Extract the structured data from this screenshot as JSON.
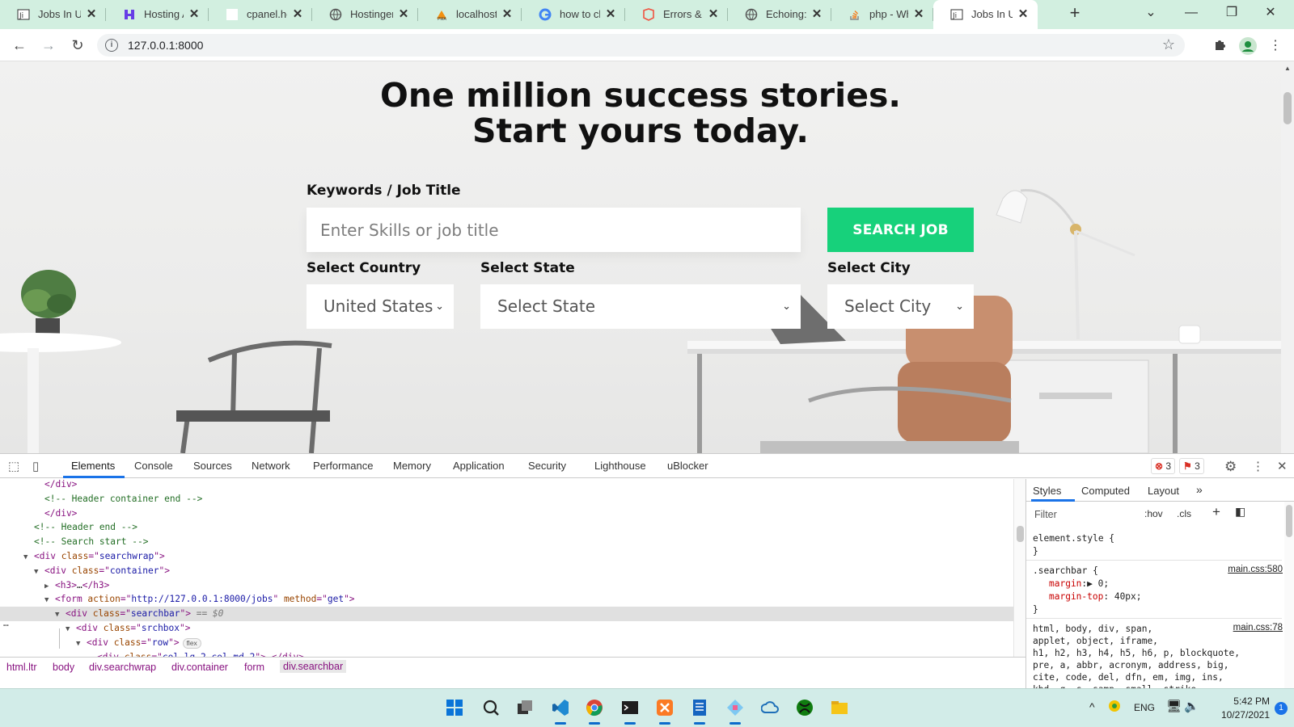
{
  "tabs": [
    {
      "title": "Jobs In Ur",
      "icon": "job-favicon",
      "active": false
    },
    {
      "title": "Hosting A",
      "icon": "hostinger-favicon",
      "active": false
    },
    {
      "title": "cpanel.ho",
      "icon": "blank-favicon",
      "active": false
    },
    {
      "title": "Hostinger",
      "icon": "globe-favicon",
      "active": false
    },
    {
      "title": "localhost",
      "icon": "phpmyadmin-favicon",
      "active": false
    },
    {
      "title": "how to ch",
      "icon": "google-favicon",
      "active": false
    },
    {
      "title": "Errors & L",
      "icon": "laravel-favicon",
      "active": false
    },
    {
      "title": "Echoing: c",
      "icon": "globe-favicon",
      "active": false
    },
    {
      "title": "php - Wh",
      "icon": "stackoverflow-favicon",
      "active": false
    },
    {
      "title": "Jobs In Ur",
      "icon": "job-favicon",
      "active": true
    }
  ],
  "address_bar": {
    "url": "127.0.0.1:8000"
  },
  "page": {
    "hero_line1": "One million success stories.",
    "hero_line2": "Start yours today.",
    "keywords_label": "Keywords / Job Title",
    "keywords_placeholder": "Enter Skills or job title",
    "search_button": "SEARCH JOB",
    "country_label": "Select Country",
    "country_value": "United States",
    "state_label": "Select State",
    "state_value": "Select State",
    "city_label": "Select City",
    "city_value": "Select City"
  },
  "devtools": {
    "tabs": [
      "Elements",
      "Console",
      "Sources",
      "Network",
      "Performance",
      "Memory",
      "Application",
      "Security",
      "Lighthouse",
      "uBlocker"
    ],
    "active_tab": "Elements",
    "errors_count": "3",
    "issues_count": "3",
    "dom_lines": [
      {
        "indent": 1,
        "tri": "",
        "parts": [
          [
            "tg",
            "</div>"
          ]
        ]
      },
      {
        "indent": 1,
        "tri": "",
        "parts": [
          [
            "cm",
            "<!-- Header container end -->"
          ]
        ]
      },
      {
        "indent": 1,
        "tri": "",
        "parts": [
          [
            "tg",
            "</div>"
          ]
        ]
      },
      {
        "indent": 0,
        "tri": "",
        "parts": [
          [
            "cm",
            "<!-- Header end -->"
          ]
        ]
      },
      {
        "indent": 0,
        "tri": "",
        "parts": [
          [
            "cm",
            "<!-- Search start -->"
          ]
        ]
      },
      {
        "indent": 0,
        "tri": "▼",
        "parts": [
          [
            "tg",
            "<div "
          ],
          [
            "an",
            "class"
          ],
          [
            "tg",
            "=\""
          ],
          [
            "av",
            "searchwrap"
          ],
          [
            "tg",
            "\">"
          ]
        ]
      },
      {
        "indent": 1,
        "tri": "▼",
        "parts": [
          [
            "tg",
            "<div "
          ],
          [
            "an",
            "class"
          ],
          [
            "tg",
            "=\""
          ],
          [
            "av",
            "container"
          ],
          [
            "tg",
            "\">"
          ]
        ]
      },
      {
        "indent": 2,
        "tri": "▶",
        "parts": [
          [
            "tg",
            "<h3>"
          ],
          [
            "tx",
            "…"
          ],
          [
            "tg",
            "</h3>"
          ]
        ]
      },
      {
        "indent": 2,
        "tri": "▼",
        "parts": [
          [
            "tg",
            "<form "
          ],
          [
            "an",
            "action"
          ],
          [
            "tg",
            "=\""
          ],
          [
            "av",
            "http://127.0.0.1:8000/jobs"
          ],
          [
            "tg",
            "\" "
          ],
          [
            "an",
            "method"
          ],
          [
            "tg",
            "=\""
          ],
          [
            "av",
            "get"
          ],
          [
            "tg",
            "\">"
          ]
        ]
      },
      {
        "indent": 3,
        "tri": "▼",
        "parts": [
          [
            "tg",
            "<div "
          ],
          [
            "an",
            "class"
          ],
          [
            "tg",
            "=\""
          ],
          [
            "av",
            "searchbar"
          ],
          [
            "tg",
            "\">"
          ],
          [
            "tx",
            " == $0"
          ]
        ],
        "selected": true
      },
      {
        "indent": 4,
        "tri": "▼",
        "parts": [
          [
            "tg",
            "<div "
          ],
          [
            "an",
            "class"
          ],
          [
            "tg",
            "=\""
          ],
          [
            "av",
            "srchbox"
          ],
          [
            "tg",
            "\">"
          ]
        ]
      },
      {
        "indent": 5,
        "tri": "▼",
        "parts": [
          [
            "tg",
            "<div "
          ],
          [
            "an",
            "class"
          ],
          [
            "tg",
            "=\""
          ],
          [
            "av",
            "row"
          ],
          [
            "tg",
            "\">"
          ]
        ],
        "flex": "flex"
      },
      {
        "indent": 6,
        "tri": "",
        "parts": [
          [
            "tg",
            "<div "
          ],
          [
            "an",
            "class"
          ],
          [
            "tg",
            "=\""
          ],
          [
            "av",
            "col-lg-2 col-md-2"
          ],
          [
            "tg",
            "\"> </div>"
          ]
        ]
      }
    ],
    "breadcrumbs": [
      "html.ltr",
      "body",
      "div.searchwrap",
      "div.container",
      "form",
      "div.searchbar"
    ],
    "styles_tabs": [
      "Styles",
      "Computed",
      "Layout"
    ],
    "filter_placeholder": "Filter",
    "hov": ":hov",
    "cls": ".cls",
    "element_style": "element.style {",
    "rule_searchbar_selector": ".searchbar {",
    "rule_searchbar_src": "main.css:580",
    "rule_searchbar_props": [
      [
        "margin",
        "▶ 0;"
      ],
      [
        "margin-top",
        " 40px;"
      ]
    ],
    "rule_reset_selector": "html, body, div, span,",
    "rule_reset_src": "main.css:78",
    "rule_reset_lines": [
      "applet, object, iframe,",
      "h1, h2, h3, h4, h5, h6, p, blockquote,",
      "pre, a, abbr, acronym, address, big,",
      "cite, code, del, dfn, em, img, ins,",
      "kbd, q, s, samp, small, strike,"
    ]
  },
  "taskbar": {
    "apps": [
      "windows-start-icon",
      "search-icon",
      "task-view-icon",
      "vscode-icon",
      "chrome-icon",
      "terminal-icon",
      "xampp-icon",
      "notes-icon",
      "plugin-icon",
      "cloud-icon",
      "xbox-icon",
      "file-explorer-icon"
    ],
    "language": "ENG",
    "time": "5:42 PM",
    "date": "10/27/2021",
    "notifications": "1"
  }
}
